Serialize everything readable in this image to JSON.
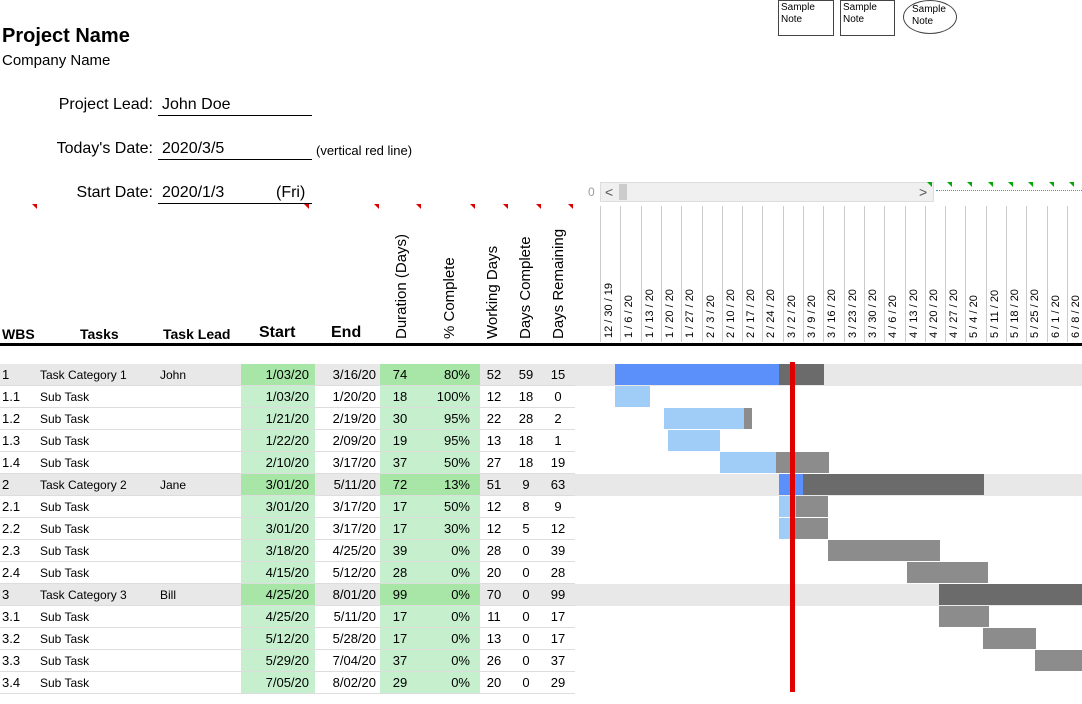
{
  "project": {
    "name": "Project Name",
    "company": "Company Name"
  },
  "fields": {
    "lead_label": "Project Lead:",
    "lead_value": "John Doe",
    "today_label": "Today's Date:",
    "today_value": "2020/3/5",
    "today_note": "(vertical red line)",
    "start_label": "Start Date:",
    "start_value": "2020/1/3",
    "start_day": "(Fri)"
  },
  "notes": [
    "Sample Note",
    "Sample Note",
    "Sample Note"
  ],
  "scroll": {
    "value": "0",
    "left": "<",
    "right": ">"
  },
  "headers": {
    "wbs": "WBS",
    "tasks": "Tasks",
    "lead": "Task Lead",
    "start": "Start",
    "end": "End",
    "duration": "Duration (Days)",
    "pct": "% Complete",
    "working": "Working Days",
    "done": "Days Complete",
    "remaining": "Days Remaining"
  },
  "timeline_dates": [
    "12 / 30 / 19",
    "1 / 6 / 20",
    "1 / 13 / 20",
    "1 / 20 / 20",
    "1 / 27 / 20",
    "2 / 3 / 20",
    "2 / 10 / 20",
    "2 / 17 / 20",
    "2 / 24 / 20",
    "3 / 2 / 20",
    "3 / 9 / 20",
    "3 / 16 / 20",
    "3 / 23 / 20",
    "3 / 30 / 20",
    "4 / 6 / 20",
    "4 / 13 / 20",
    "4 / 20 / 20",
    "4 / 27 / 20",
    "5 / 4 / 20",
    "5 / 11 / 20",
    "5 / 18 / 20",
    "5 / 25 / 20",
    "6 / 1 / 20",
    "6 / 8 / 20"
  ],
  "colors": {
    "today_line": "#e00000",
    "done_cat": "#5b8ff9",
    "done_sub": "#9fcdf7",
    "remain_cat": "#6b6b6b",
    "remain_sub": "#8c8c8c",
    "cell_green": "#c6efce"
  },
  "rows": [
    {
      "wbs": "1",
      "task": "Task Category 1",
      "lead": "John",
      "start": "1/03/20",
      "end": "3/16/20",
      "dur": "74",
      "pct": "80%",
      "wd": "52",
      "dc": "59",
      "dr": "15",
      "cat": true
    },
    {
      "wbs": "1.1",
      "task": "Sub Task",
      "lead": "",
      "start": "1/03/20",
      "end": "1/20/20",
      "dur": "18",
      "pct": "100%",
      "wd": "12",
      "dc": "18",
      "dr": "0",
      "cat": false
    },
    {
      "wbs": "1.2",
      "task": "Sub Task",
      "lead": "",
      "start": "1/21/20",
      "end": "2/19/20",
      "dur": "30",
      "pct": "95%",
      "wd": "22",
      "dc": "28",
      "dr": "2",
      "cat": false
    },
    {
      "wbs": "1.3",
      "task": "Sub Task",
      "lead": "",
      "start": "1/22/20",
      "end": "2/09/20",
      "dur": "19",
      "pct": "95%",
      "wd": "13",
      "dc": "18",
      "dr": "1",
      "cat": false
    },
    {
      "wbs": "1.4",
      "task": "Sub Task",
      "lead": "",
      "start": "2/10/20",
      "end": "3/17/20",
      "dur": "37",
      "pct": "50%",
      "wd": "27",
      "dc": "18",
      "dr": "19",
      "cat": false
    },
    {
      "wbs": "2",
      "task": "Task Category 2",
      "lead": "Jane",
      "start": "3/01/20",
      "end": "5/11/20",
      "dur": "72",
      "pct": "13%",
      "wd": "51",
      "dc": "9",
      "dr": "63",
      "cat": true
    },
    {
      "wbs": "2.1",
      "task": "Sub Task",
      "lead": "",
      "start": "3/01/20",
      "end": "3/17/20",
      "dur": "17",
      "pct": "50%",
      "wd": "12",
      "dc": "8",
      "dr": "9",
      "cat": false
    },
    {
      "wbs": "2.2",
      "task": "Sub Task",
      "lead": "",
      "start": "3/01/20",
      "end": "3/17/20",
      "dur": "17",
      "pct": "30%",
      "wd": "12",
      "dc": "5",
      "dr": "12",
      "cat": false
    },
    {
      "wbs": "2.3",
      "task": "Sub Task",
      "lead": "",
      "start": "3/18/20",
      "end": "4/25/20",
      "dur": "39",
      "pct": "0%",
      "wd": "28",
      "dc": "0",
      "dr": "39",
      "cat": false
    },
    {
      "wbs": "2.4",
      "task": "Sub Task",
      "lead": "",
      "start": "4/15/20",
      "end": "5/12/20",
      "dur": "28",
      "pct": "0%",
      "wd": "20",
      "dc": "0",
      "dr": "28",
      "cat": false
    },
    {
      "wbs": "3",
      "task": "Task Category 3",
      "lead": "Bill",
      "start": "4/25/20",
      "end": "8/01/20",
      "dur": "99",
      "pct": "0%",
      "wd": "70",
      "dc": "0",
      "dr": "99",
      "cat": true
    },
    {
      "wbs": "3.1",
      "task": "Sub Task",
      "lead": "",
      "start": "4/25/20",
      "end": "5/11/20",
      "dur": "17",
      "pct": "0%",
      "wd": "11",
      "dc": "0",
      "dr": "17",
      "cat": false
    },
    {
      "wbs": "3.2",
      "task": "Sub Task",
      "lead": "",
      "start": "5/12/20",
      "end": "5/28/20",
      "dur": "17",
      "pct": "0%",
      "wd": "13",
      "dc": "0",
      "dr": "17",
      "cat": false
    },
    {
      "wbs": "3.3",
      "task": "Sub Task",
      "lead": "",
      "start": "5/29/20",
      "end": "7/04/20",
      "dur": "37",
      "pct": "0%",
      "wd": "26",
      "dc": "0",
      "dr": "37",
      "cat": false
    },
    {
      "wbs": "3.4",
      "task": "Sub Task",
      "lead": "",
      "start": "7/05/20",
      "end": "8/02/20",
      "dur": "29",
      "pct": "0%",
      "wd": "20",
      "dc": "0",
      "dr": "29",
      "cat": false
    }
  ]
}
